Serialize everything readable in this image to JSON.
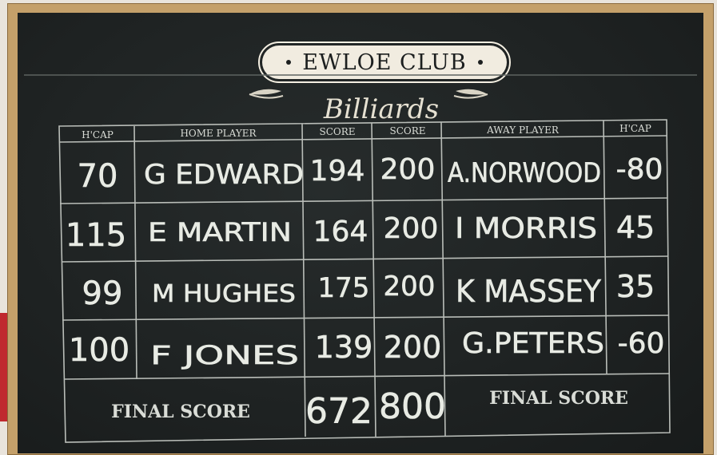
{
  "club_name": "EWLOE CLUB",
  "subtitle": "Billiards",
  "headers": {
    "home_hcap": "H'CAP",
    "home_player": "HOME PLAYER",
    "home_score": "SCORE",
    "away_score": "SCORE",
    "away_player": "AWAY PLAYER",
    "away_hcap": "H'CAP"
  },
  "rows": [
    {
      "home_hcap": "70",
      "home_player": "G EDWARD",
      "home_score": "194",
      "away_score": "200",
      "away_player": "A.NORWOOD",
      "away_hcap": "-80"
    },
    {
      "home_hcap": "115",
      "home_player": "E MARTIN",
      "home_score": "164",
      "away_score": "200",
      "away_player": "I MORRIS",
      "away_hcap": "45"
    },
    {
      "home_hcap": "99",
      "home_player": "M HUGHES",
      "home_score": "175",
      "away_score": "200",
      "away_player": "K MASSEY",
      "away_hcap": "35"
    },
    {
      "home_hcap": "100",
      "home_player": "F JONES",
      "home_score": "139",
      "away_score": "200",
      "away_player": "G.PETERS",
      "away_hcap": "-60"
    }
  ],
  "final_label_home": "FINAL SCORE",
  "final_label_away": "FINAL SCORE",
  "final_home": "672",
  "final_away": "800",
  "colors": {
    "board": "#1f2323",
    "frame": "#c4a06a",
    "chalk": "#e8ebe4",
    "header_pill": "#f1ece0"
  }
}
